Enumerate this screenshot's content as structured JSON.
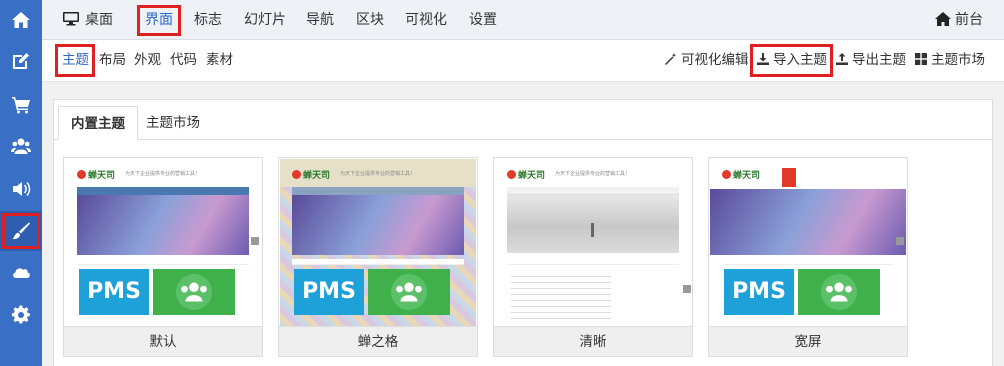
{
  "topnav": {
    "items": [
      {
        "label": "桌面",
        "icon": "desktop-icon"
      },
      {
        "label": "界面",
        "active": true
      },
      {
        "label": "标志"
      },
      {
        "label": "幻灯片"
      },
      {
        "label": "导航"
      },
      {
        "label": "区块"
      },
      {
        "label": "可视化"
      },
      {
        "label": "设置"
      }
    ],
    "frontend": {
      "label": "前台",
      "icon": "home-icon"
    }
  },
  "sidebar": {
    "icons": [
      "home-icon",
      "edit-icon",
      "cart-icon",
      "users-icon",
      "volume-icon",
      "brush-icon",
      "cloud-icon",
      "gear-icon"
    ],
    "active_icon": "brush-icon"
  },
  "subnav": {
    "items": [
      {
        "label": "主题",
        "active": true
      },
      {
        "label": "布局"
      },
      {
        "label": "外观"
      },
      {
        "label": "代码"
      },
      {
        "label": "素材"
      }
    ],
    "actions": [
      {
        "label": "可视化编辑",
        "icon": "magic-wand-icon"
      },
      {
        "label": "导入主题",
        "icon": "download-icon",
        "highlighted": true
      },
      {
        "label": "导出主题",
        "icon": "upload-icon"
      },
      {
        "label": "主题市场",
        "icon": "grid-icon"
      }
    ]
  },
  "tabs": {
    "builtin": "内置主题",
    "market": "主题市场"
  },
  "themes": [
    {
      "name": "默认"
    },
    {
      "name": "蝉之格"
    },
    {
      "name": "清晰"
    },
    {
      "name": "宽屏"
    }
  ],
  "thumb": {
    "logo": "蝉天司",
    "slogan": "为天下企业提供专业的营销工具！",
    "pms": "PMS"
  },
  "colors": {
    "sidebar": "#3a6fc6",
    "accent": "#2a6ac8",
    "highlight_border": "#e02020"
  }
}
